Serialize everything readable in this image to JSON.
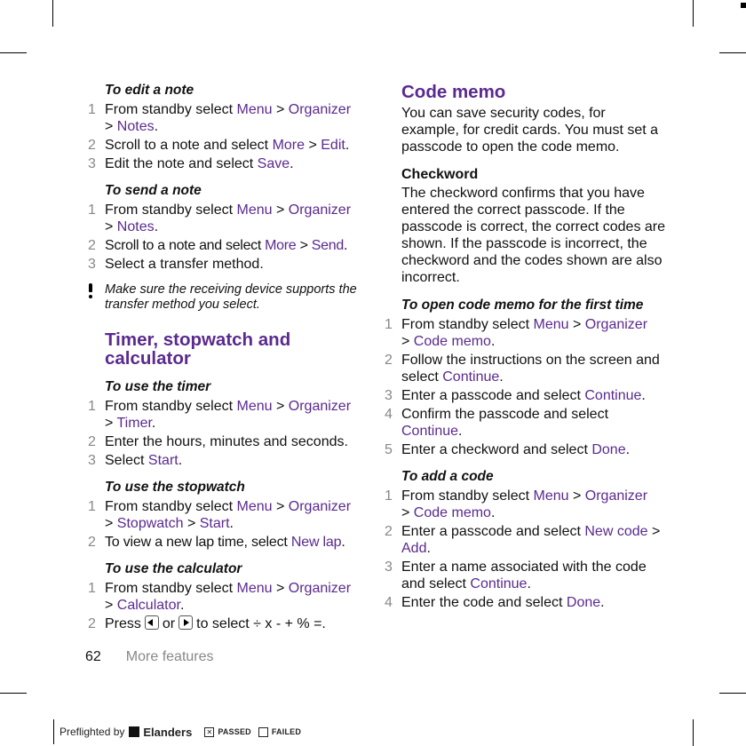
{
  "left_column": {
    "edit_note": {
      "title": "To edit a note",
      "steps": [
        {
          "n": "1",
          "a": "From standby select ",
          "l1": "Menu",
          "b": " > ",
          "l2": "Organizer",
          "c": " > ",
          "l3": "Notes",
          "d": "."
        },
        {
          "n": "2",
          "a": "Scroll to a note and select ",
          "l1": "More",
          "b": " > ",
          "l2": "Edit",
          "c": "."
        },
        {
          "n": "3",
          "a": "Edit the note and select ",
          "l1": "Save",
          "b": "."
        }
      ]
    },
    "send_note": {
      "title": "To send a note",
      "steps": [
        {
          "n": "1",
          "a": "From standby select ",
          "l1": "Menu",
          "b": " > ",
          "l2": "Organizer",
          "c": " > ",
          "l3": "Notes",
          "d": "."
        },
        {
          "n": "2",
          "a": "Scroll to a note and select ",
          "l1": "More",
          "b": " > ",
          "l2": "Send",
          "c": "."
        },
        {
          "n": "3",
          "a": "Select a transfer method."
        }
      ]
    },
    "note": "Make sure the receiving device supports the transfer method you select.",
    "section_title": "Timer, stopwatch and calculator",
    "timer": {
      "title": "To use the timer",
      "steps": [
        {
          "n": "1",
          "a": "From standby select ",
          "l1": "Menu",
          "b": " > ",
          "l2": "Organizer",
          "c": " > ",
          "l3": "Timer",
          "d": "."
        },
        {
          "n": "2",
          "a": "Enter the hours, minutes and seconds."
        },
        {
          "n": "3",
          "a": "Select ",
          "l1": "Start",
          "b": "."
        }
      ]
    },
    "stopwatch": {
      "title": "To use the stopwatch",
      "steps": [
        {
          "n": "1",
          "a": "From standby select ",
          "l1": "Menu",
          "b": " > ",
          "l2": "Organizer",
          "c": " > ",
          "l3": "Stopwatch",
          "d": " > ",
          "l4": "Start",
          "e": "."
        },
        {
          "n": "2",
          "a": "To view a new lap time, select ",
          "l1": "New lap",
          "b": "."
        }
      ]
    },
    "calculator": {
      "title": "To use the calculator",
      "steps": [
        {
          "n": "1",
          "a": "From standby select ",
          "l1": "Menu",
          "b": " > ",
          "l2": "Organizer",
          "c": " > ",
          "l3": "Calculator",
          "d": "."
        },
        {
          "n": "2",
          "a": "Press",
          "or": "or",
          "rest": "to select ÷ x - + % =.",
          "icons": [
            "nav-left-key-icon",
            "nav-right-key-icon"
          ]
        }
      ]
    }
  },
  "right_column": {
    "section_title": "Code memo",
    "intro": "You can save security codes, for example, for credit cards. You must set a passcode to open the code memo.",
    "checkword_title": "Checkword",
    "checkword_text": "The checkword confirms that you have entered the correct passcode. If the passcode is correct, the correct codes are shown. If the passcode is incorrect, the checkword and the codes shown are also incorrect.",
    "open_first": {
      "title": "To open code memo for the first time",
      "steps": [
        {
          "n": "1",
          "a": "From standby select ",
          "l1": "Menu",
          "b": " > ",
          "l2": "Organizer",
          "c": " > ",
          "l3": "Code memo",
          "d": "."
        },
        {
          "n": "2",
          "a": "Follow the instructions on the screen and select ",
          "l1": "Continue",
          "b": "."
        },
        {
          "n": "3",
          "a": "Enter a passcode and select ",
          "l1": "Continue",
          "b": "."
        },
        {
          "n": "4",
          "a": "Confirm the passcode and select ",
          "l1": "Continue",
          "b": "."
        },
        {
          "n": "5",
          "a": "Enter a checkword and select ",
          "l1": "Done",
          "b": "."
        }
      ]
    },
    "add_code": {
      "title": "To add a code",
      "steps": [
        {
          "n": "1",
          "a": "From standby select ",
          "l1": "Menu",
          "b": " > ",
          "l2": "Organizer",
          "c": " > ",
          "l3": "Code memo",
          "d": "."
        },
        {
          "n": "2",
          "a": "Enter a passcode and select ",
          "l1": "New code",
          "b": " > ",
          "l2": "Add",
          "c": "."
        },
        {
          "n": "3",
          "a": "Enter a name associated with the code and select ",
          "l1": "Continue",
          "b": "."
        },
        {
          "n": "4",
          "a": "Enter the code and select ",
          "l1": "Done",
          "b": "."
        }
      ]
    }
  },
  "footer": {
    "page_number": "62",
    "section": "More features"
  },
  "preflight": {
    "label": "Preflighted by",
    "brand": "Elanders",
    "passed_mark": "✕",
    "passed": "PASSED",
    "failed_mark": "",
    "failed": "FAILED"
  },
  "colors": {
    "accent": "#5a2a8f",
    "step_number": "#888888",
    "text": "#111111"
  }
}
